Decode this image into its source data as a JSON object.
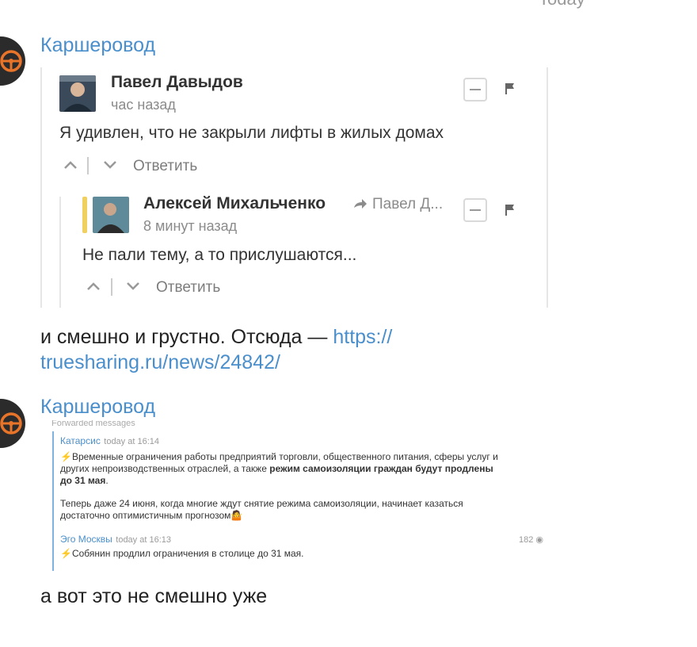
{
  "date_separator": "Today",
  "messages": [
    {
      "channel": "Каршеровод",
      "comment": {
        "author": "Павел Давыдов",
        "time": "час назад",
        "text": "Я удивлен, что не закрыли лифты в жилых домах",
        "reply_label": "Ответить"
      },
      "reply": {
        "author": "Алексей Михальченко",
        "to": "Павел Д...",
        "time": "8 минут назад",
        "text": "Не пали тему, а то прислушаются...",
        "reply_label": "Ответить"
      },
      "text": "и смешно и грустно. Отсюда —",
      "link": "https://truesharing.ru/news/24842/",
      "link_line1": "https://",
      "link_line2": "truesharing.ru/news/24842/"
    },
    {
      "channel": "Каршеровод",
      "forwarded_header": "Forwarded messages",
      "forwards": [
        {
          "source": "Катарсис",
          "time": "today at 16:14",
          "line1": "Временные ограничения работы предприятий торговли, общественного питания, сферы услуг и",
          "line2": "других непроизводственных отраслей, а также",
          "line2_bold": "режим самоизоляции граждан будут продлены",
          "line3_bold": "до 31 мая",
          "line3_tail": ".",
          "para2_line1": "Теперь даже 24 июня, когда многие ждут снятие режима самоизоляции, начинает казаться",
          "para2_line2": "достаточно оптимистичным прогнозом"
        },
        {
          "source": "Эго Москвы",
          "time": "today at 16:13",
          "views": "182",
          "line1": "Собянин продлил ограничения в столице до 31 мая."
        }
      ],
      "text": "а вот это не смешно уже"
    }
  ],
  "colors": {
    "link": "#4a8fcc",
    "accent_bar": "#f0d060",
    "lightning": "#f5b400"
  }
}
